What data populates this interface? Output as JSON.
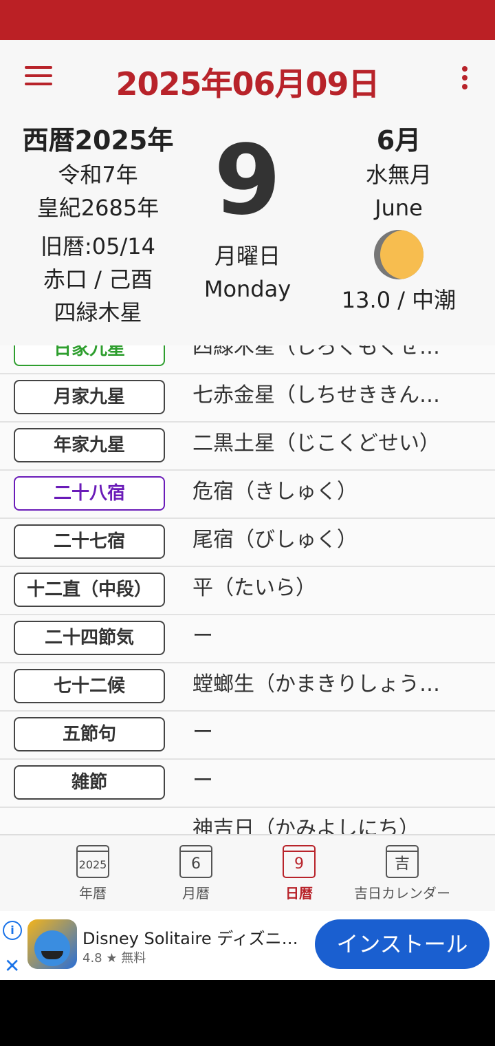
{
  "header": {
    "title": "2025年06月09日"
  },
  "date_info": {
    "left": [
      "西暦2025年",
      "令和7年",
      "皇紀2685年",
      "旧暦:05/14",
      "赤口 / 己酉",
      "四緑木星"
    ],
    "day": "9",
    "weekday_jp": "月曜日",
    "weekday_en": "Monday",
    "month_num": "6月",
    "month_jp": "水無月",
    "month_en": "June",
    "moon": "13.0 / 中潮"
  },
  "rows": [
    {
      "tag": "日家九星",
      "value": "四緑木星（しろくもくせ…",
      "tag_color": "#2e9e2e"
    },
    {
      "tag": "月家九星",
      "value": "七赤金星（しちせききん…"
    },
    {
      "tag": "年家九星",
      "value": "二黒土星（じこくどせい）"
    },
    {
      "tag": "二十八宿",
      "value": "危宿（きしゅく）",
      "tag_color": "#6a1bb8"
    },
    {
      "tag": "二十七宿",
      "value": "尾宿（びしゅく）"
    },
    {
      "tag": "十二直（中段）",
      "value": "平（たいら）"
    },
    {
      "tag": "二十四節気",
      "value": "ー"
    },
    {
      "tag": "七十二候",
      "value": "螳螂生（かまきりしょう…"
    },
    {
      "tag": "五節句",
      "value": "ー"
    },
    {
      "tag": "雑節",
      "value": "ー"
    },
    {
      "tag": "",
      "value": "神吉日（かみよしにち）"
    }
  ],
  "tabs": [
    {
      "icon_text": "2025",
      "label": "年暦"
    },
    {
      "icon_text": "6",
      "label": "月暦"
    },
    {
      "icon_text": "9",
      "label": "日暦"
    },
    {
      "icon_text": "吉",
      "label": "吉日カレンダー"
    }
  ],
  "ad": {
    "title": "Disney Solitaire ディズニー…",
    "rating": "4.8 ★ 無料",
    "button": "インストール",
    "info_icon": "info-icon",
    "close_icon": "close-icon"
  },
  "colors": {
    "accent": "#b8232a",
    "status_bar": "#bb2025",
    "ad_button": "#1a5fd0"
  }
}
